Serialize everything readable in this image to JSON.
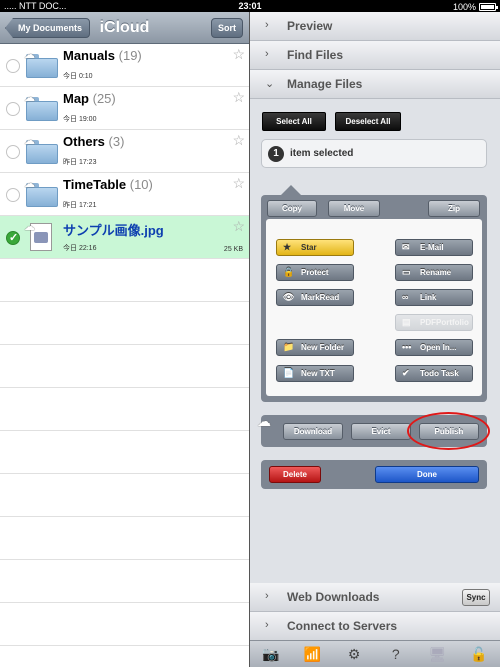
{
  "status_bar": {
    "carrier": "..... NTT DOC...",
    "time": "23:01",
    "battery": "100%",
    "battery_level": 1.0
  },
  "left": {
    "back_label": "My Documents",
    "title": "iCloud",
    "sort_label": "Sort",
    "files": [
      {
        "name": "Manuals",
        "count": "(19)",
        "date": "今日 0:10",
        "size": "",
        "type": "folder",
        "selected": false
      },
      {
        "name": "Map",
        "count": "(25)",
        "date": "今日 19:00",
        "size": "",
        "type": "folder",
        "selected": false
      },
      {
        "name": "Others",
        "count": "(3)",
        "date": "昨日 17:23",
        "size": "",
        "type": "folder",
        "selected": false
      },
      {
        "name": "TimeTable",
        "count": "(10)",
        "date": "昨日 17:21",
        "size": "",
        "type": "folder",
        "selected": false
      },
      {
        "name": "サンプル画像.jpg",
        "count": "",
        "date": "今日 22:16",
        "size": "25 KB",
        "type": "image",
        "selected": true
      }
    ]
  },
  "right": {
    "sections_top": [
      {
        "label": "Preview",
        "chevron": "›"
      },
      {
        "label": "Find Files",
        "chevron": "›"
      },
      {
        "label": "Manage Files",
        "chevron": "⌄"
      }
    ],
    "select_all": "Select All",
    "deselect_all": "Deselect All",
    "selected_count": "1",
    "selected_text": "item selected",
    "top_buttons": {
      "copy": "Copy",
      "move": "Move",
      "zip": "Zip"
    },
    "actions_left": [
      {
        "label": "Star",
        "icon": "★"
      },
      {
        "label": "Protect",
        "icon": "🔒"
      },
      {
        "label": "MarkRead",
        "icon": "👁"
      },
      {
        "label": "New Folder",
        "icon": "📁"
      },
      {
        "label": "New TXT",
        "icon": "📄"
      }
    ],
    "actions_right": [
      {
        "label": "E-Mail",
        "icon": "✉"
      },
      {
        "label": "Rename",
        "icon": "▭"
      },
      {
        "label": "Link",
        "icon": "∞"
      },
      {
        "label": "PDFPortfolio",
        "icon": "▤"
      },
      {
        "label": "Open In...",
        "icon": "•••"
      },
      {
        "label": "Todo Task",
        "icon": "✔"
      }
    ],
    "cloud_buttons": {
      "download": "Download",
      "evict": "Evict",
      "publish": "Publish"
    },
    "delete_label": "Delete",
    "done_label": "Done",
    "sections_bottom": [
      {
        "label": "Web Downloads",
        "chevron": "›",
        "button": "Sync"
      },
      {
        "label": "Connect to Servers",
        "chevron": "›",
        "button": ""
      }
    ],
    "toolbar_icons": [
      "camera-icon",
      "wifi-icon",
      "gear-icon",
      "help-icon",
      "monitor-icon",
      "lock-icon"
    ]
  }
}
